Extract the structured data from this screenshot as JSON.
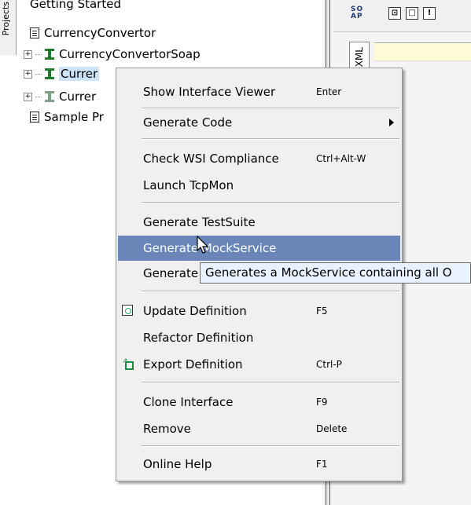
{
  "tree": {
    "side_tab_label": "Projects",
    "items": [
      {
        "label": "Getting Started"
      },
      {
        "label": "CurrencyConvertor"
      },
      {
        "label": "CurrencyConvertorSoap"
      },
      {
        "label": "Currer"
      },
      {
        "label": "Currer"
      },
      {
        "label": "Sample Pr"
      }
    ]
  },
  "right_panel": {
    "soap_badge": "SO\nAP",
    "toolbar_buttons": [
      "⊡",
      "□",
      "!"
    ],
    "vertical_tab": "XML"
  },
  "context_menu": {
    "items": {
      "show_interface_viewer": {
        "label": "Show Interface Viewer",
        "accel": "Enter"
      },
      "generate_code": {
        "label": "Generate Code"
      },
      "check_wsi": {
        "label": "Check WSI Compliance",
        "accel": "Ctrl+Alt-W"
      },
      "launch_tcpmon": {
        "label": "Launch TcpMon"
      },
      "generate_testsuite": {
        "label": "Generate TestSuite"
      },
      "generate_mockservice": {
        "label": "Generate MockService"
      },
      "generate_other": {
        "label": "Generate"
      },
      "update_definition": {
        "label": "Update Definition",
        "accel": "F5"
      },
      "refactor_definition": {
        "label": "Refactor Definition"
      },
      "export_definition": {
        "label": "Export Definition",
        "accel": "Ctrl-P"
      },
      "clone_interface": {
        "label": "Clone Interface",
        "accel": "F9"
      },
      "remove": {
        "label": "Remove",
        "accel": "Delete"
      },
      "online_help": {
        "label": "Online Help",
        "accel": "F1"
      }
    }
  },
  "tooltip": {
    "text": "Generates a MockService containing all O"
  },
  "colors": {
    "menu_highlight": "#6a86b8",
    "selection": "#cde3f7",
    "tooltip_bg": "#e8f2fe"
  }
}
